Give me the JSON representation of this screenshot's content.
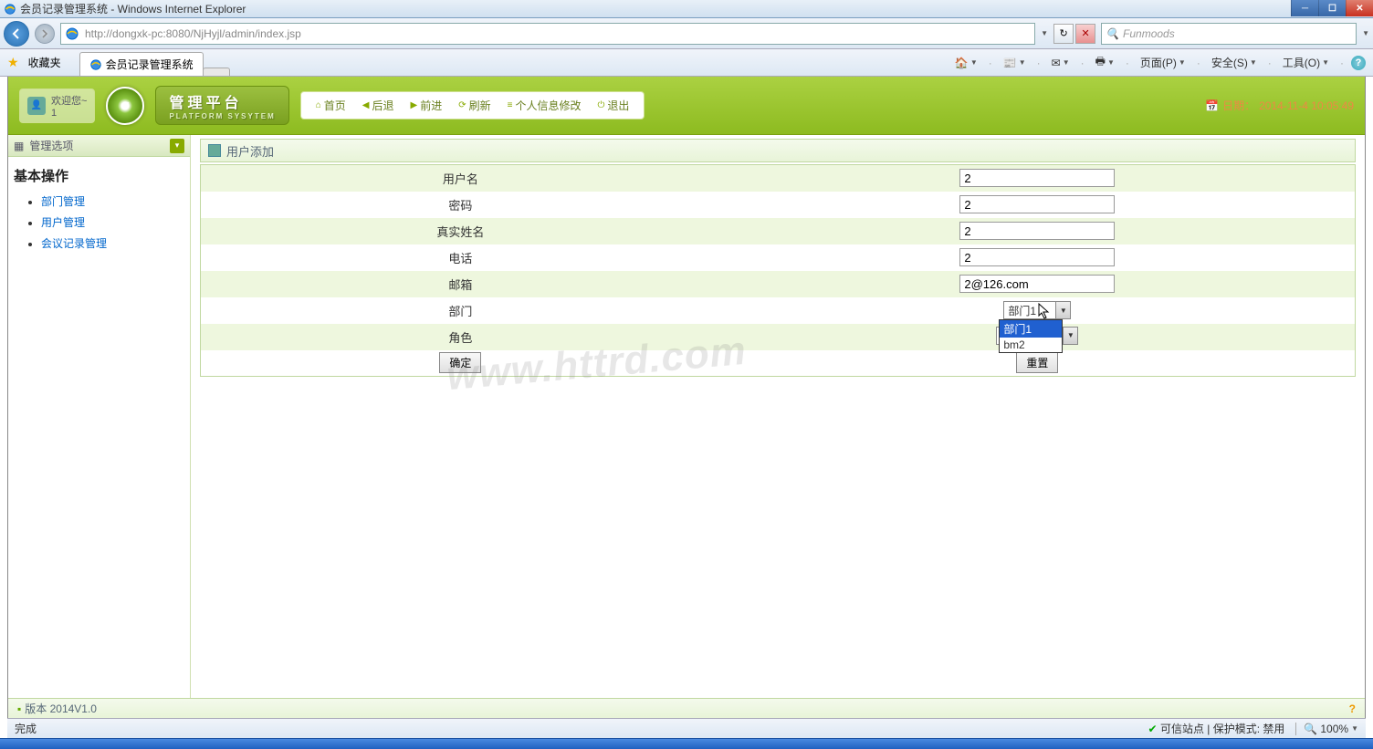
{
  "window": {
    "title": "会员记录管理系统 - Windows Internet Explorer"
  },
  "address": {
    "url": "http://dongxk-pc:8080/NjHyjl/admin/index.jsp"
  },
  "search": {
    "placeholder": "Funmoods"
  },
  "favorites_label": "收藏夹",
  "tab": {
    "title": "会员记录管理系统"
  },
  "toolbar": {
    "page": "页面(P)",
    "safety": "安全(S)",
    "tools": "工具(O)"
  },
  "app": {
    "welcome_prefix": "欢迎您~",
    "welcome_user": "1",
    "platform_title": "管理平台",
    "platform_sub": "PLATFORM SYSYTEM",
    "nav": {
      "home": "首页",
      "back": "后退",
      "fwd": "前进",
      "refresh": "刷新",
      "profile": "个人信息修改",
      "logout": "退出"
    },
    "date_label": "日期：",
    "date_value": "2014-11-4 10:05:49"
  },
  "sidebar": {
    "header": "管理选项",
    "heading": "基本操作",
    "links": [
      "部门管理",
      "用户管理",
      "会议记录管理"
    ]
  },
  "panel": {
    "title": "用户添加"
  },
  "form": {
    "labels": {
      "username": "用户名",
      "password": "密码",
      "realname": "真实姓名",
      "phone": "电话",
      "email": "邮箱",
      "dept": "部门",
      "role": "角色"
    },
    "values": {
      "username": "2",
      "password": "2",
      "realname": "2",
      "phone": "2",
      "email": "2@126.com"
    },
    "dept_selected": "部门1",
    "dept_options": [
      "部门1",
      "bm2"
    ],
    "submit": "确定",
    "reset": "重置"
  },
  "footer": {
    "version": "版本 2014V1.0"
  },
  "ie_status": {
    "done": "完成",
    "trusted": "可信站点",
    "protection": "保护模式: 禁用",
    "zoom": "100%"
  },
  "watermark": "www.httrd.com"
}
